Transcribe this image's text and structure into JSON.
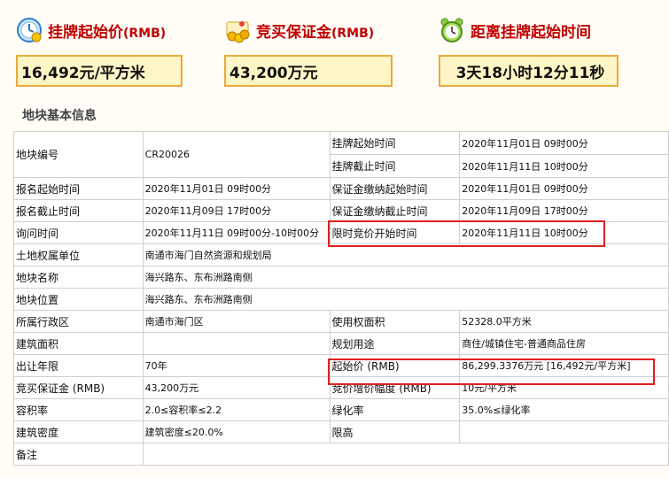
{
  "stats": [
    {
      "label": "挂牌起始价",
      "unit": "(RMB)",
      "value": "16,492元/平方米",
      "icon": "money-clock-icon"
    },
    {
      "label": "竞买保证金",
      "unit": "(RMB)",
      "value": "43,200万元",
      "icon": "coins-icon"
    },
    {
      "label": "距离挂牌起始时间",
      "unit": "",
      "value": "3天18小时12分11秒",
      "icon": "alarm-clock-icon"
    }
  ],
  "section_title": "地块基本信息",
  "table": {
    "parcel_no_label": "地块编号",
    "parcel_no": "CR20026",
    "list_start_label": "挂牌起始时间",
    "list_start": "2020年11月01日 09时00分",
    "list_end_label": "挂牌截止时间",
    "list_end": "2020年11月11日 10时00分",
    "reg_start_label": "报名起始时间",
    "reg_start": "2020年11月01日 09时00分",
    "deposit_start_label": "保证金缴纳起始时间",
    "deposit_start": "2020年11月01日 09时00分",
    "reg_end_label": "报名截止时间",
    "reg_end": "2020年11月09日 17时00分",
    "deposit_end_label": "保证金缴纳截止时间",
    "deposit_end": "2020年11月09日 17时00分",
    "inquiry_label": "询问时间",
    "inquiry": "2020年11月11日 09时00分-10时00分",
    "bid_start_label": "限时竞价开始时间",
    "bid_start": "2020年11月11日 10时00分",
    "owner_label": "土地权属单位",
    "owner": "南通市海门自然资源和规划局",
    "name_label": "地块名称",
    "name": "海兴路东、东布洲路南侧",
    "location_label": "地块位置",
    "location": "海兴路东、东布洲路南侧",
    "district_label": "所属行政区",
    "district": "南通市海门区",
    "use_area_label": "使用权面积",
    "use_area": "52328.0平方米",
    "build_area_label": "建筑面积",
    "build_area": "",
    "purpose_label": "规划用途",
    "purpose": "商住/城镇住宅-普通商品住房",
    "term_label": "出让年限",
    "term": "70年",
    "start_price_label": "起始价 (RMB)",
    "start_price": "86,299.3376万元 [16,492元/平方米]",
    "deposit_label": "竞买保证金 (RMB)",
    "deposit": "43,200万元",
    "increment_label": "竞价增价幅度 (RMB)",
    "increment": "10元/平方米",
    "far_label": "容积率",
    "far": "2.0≤容积率≤2.2",
    "green_label": "绿化率",
    "green": "35.0%≤绿化率",
    "density_label": "建筑密度",
    "density": "建筑密度≤20.0%",
    "height_label": "限高",
    "height": "",
    "remark_label": "备注",
    "remark": ""
  },
  "colors": {
    "accent": "#c00000",
    "box_border": "#e9a93d",
    "box_fill": "#fff6c7",
    "highlight": "#e02020"
  }
}
